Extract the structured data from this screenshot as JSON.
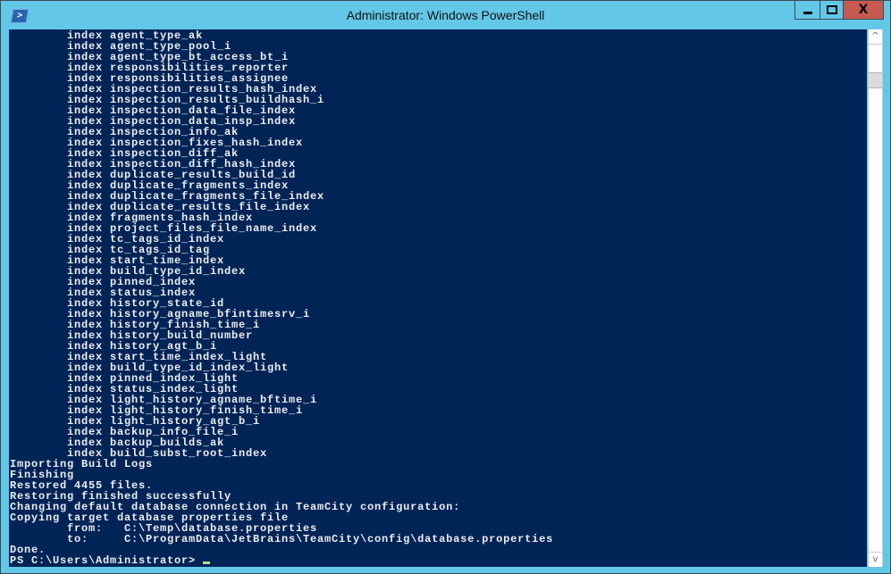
{
  "window": {
    "title": "Administrator: Windows PowerShell",
    "icon": "powershell-icon",
    "controls": {
      "minimize": "minimize-icon",
      "maximize": "maximize-icon",
      "close_label": "X"
    }
  },
  "console": {
    "lines": [
      "        index agent_type_ak",
      "        index agent_type_pool_i",
      "        index agent_type_bt_access_bt_i",
      "        index responsibilities_reporter",
      "        index responsibilities_assignee",
      "        index inspection_results_hash_index",
      "        index inspection_results_buildhash_i",
      "        index inspection_data_file_index",
      "        index inspection_data_insp_index",
      "        index inspection_info_ak",
      "        index inspection_fixes_hash_index",
      "        index inspection_diff_ak",
      "        index inspection_diff_hash_index",
      "        index duplicate_results_build_id",
      "        index duplicate_fragments_index",
      "        index duplicate_fragments_file_index",
      "        index duplicate_results_file_index",
      "        index fragments_hash_index",
      "        index project_files_file_name_index",
      "        index tc_tags_id_index",
      "        index tc_tags_id_tag",
      "        index start_time_index",
      "        index build_type_id_index",
      "        index pinned_index",
      "        index status_index",
      "        index history_state_id",
      "        index history_agname_bfintimesrv_i",
      "        index history_finish_time_i",
      "        index history_build_number",
      "        index history_agt_b_i",
      "        index start_time_index_light",
      "        index build_type_id_index_light",
      "        index pinned_index_light",
      "        index status_index_light",
      "        index light_history_agname_bftime_i",
      "        index light_history_finish_time_i",
      "        index light_history_agt_b_i",
      "        index backup_info_file_i",
      "        index backup_builds_ak",
      "        index build_subst_root_index",
      "Importing Build Logs",
      "Finishing",
      "Restored 4455 files.",
      "Restoring finished successfully",
      "Changing default database connection in TeamCity configuration:",
      "Copying target database properties file",
      "        from:   C:\\Temp\\database.properties",
      "        to:     C:\\ProgramData\\JetBrains\\TeamCity\\config\\database.properties",
      "Done."
    ],
    "prompt": "PS C:\\Users\\Administrator> "
  },
  "scrollbar": {
    "up_icon": "^",
    "down_icon": "v"
  }
}
